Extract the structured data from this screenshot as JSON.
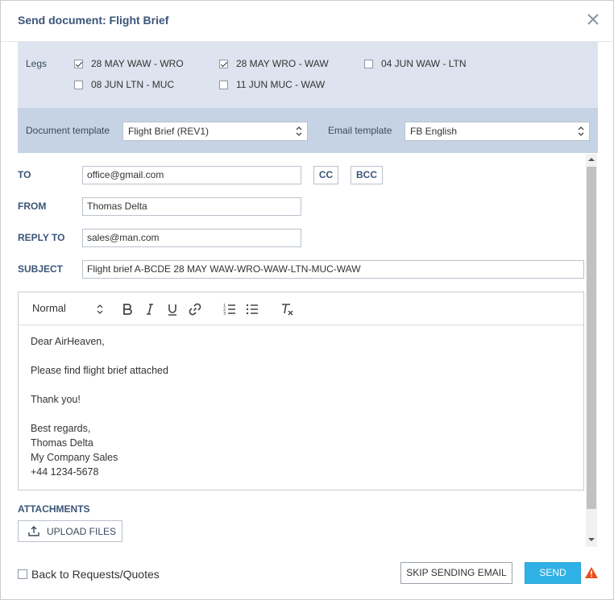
{
  "dialog": {
    "title": "Send document: Flight Brief"
  },
  "legs": {
    "label": "Legs",
    "items": [
      {
        "label": "28 MAY WAW - WRO",
        "checked": true
      },
      {
        "label": "28 MAY WRO - WAW",
        "checked": true
      },
      {
        "label": "04 JUN WAW - LTN",
        "checked": false
      },
      {
        "label": "08 JUN LTN - MUC",
        "checked": false
      },
      {
        "label": "11 JUN MUC - WAW",
        "checked": false
      }
    ]
  },
  "templates": {
    "document_label": "Document template",
    "document_value": "Flight Brief (REV1)",
    "email_label": "Email template",
    "email_value": "FB English"
  },
  "form": {
    "to_label": "TO",
    "to_value": "office@gmail.com",
    "cc_label": "CC",
    "bcc_label": "BCC",
    "from_label": "FROM",
    "from_value": "Thomas Delta",
    "reply_to_label": "REPLY TO",
    "reply_to_value": "sales@man.com",
    "subject_label": "SUBJECT",
    "subject_value": "Flight brief A-BCDE 28 MAY WAW-WRO-WAW-LTN-MUC-WAW"
  },
  "editor": {
    "format_value": "Normal",
    "body": {
      "greeting": "Dear AirHeaven,",
      "line1": "Please find flight brief attached",
      "line2": "Thank you!",
      "sign1": "Best regards,",
      "sign2": "Thomas Delta",
      "sign3": "My Company Sales",
      "sign4": "+44 1234-5678"
    }
  },
  "attachments": {
    "label": "ATTACHMENTS",
    "upload_label": "UPLOAD FILES"
  },
  "footer": {
    "back_label": "Back to Requests/Quotes",
    "back_checked": false,
    "skip_label": "SKIP SENDING EMAIL",
    "send_label": "SEND"
  },
  "colors": {
    "accent": "#3b5578",
    "send_button": "#2fb1e6",
    "warning": "#e8501e"
  }
}
